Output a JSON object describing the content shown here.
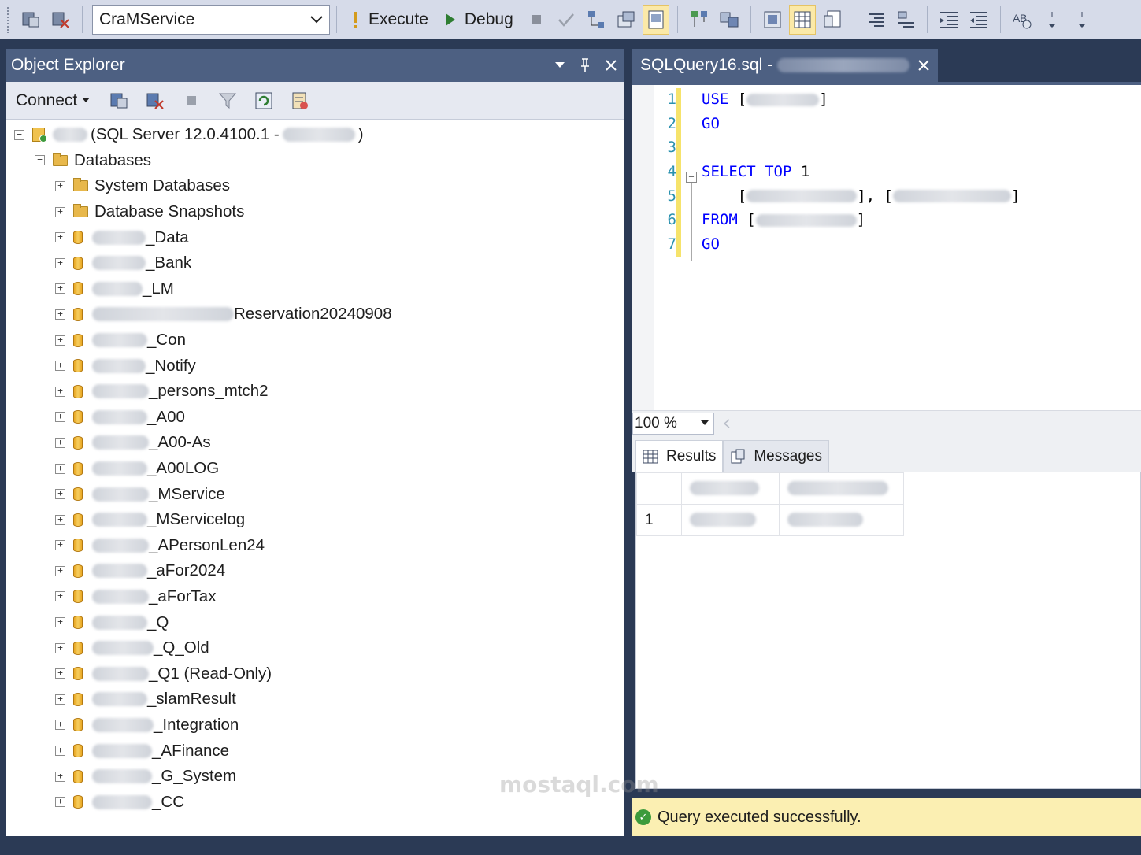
{
  "toolbar": {
    "database": "CraMService",
    "execute_label": "Execute",
    "debug_label": "Debug"
  },
  "object_explorer": {
    "title": "Object Explorer",
    "connect_label": "Connect",
    "server_label": "(SQL Server 12.0.4100.1 -",
    "server_close": ")",
    "databases_label": "Databases",
    "system_databases": "System Databases",
    "database_snapshots": "Database Snapshots",
    "databases": [
      "_Data",
      "_Bank",
      "_LM",
      "Reservation20240908",
      "_Con",
      "_Notify",
      "_persons_mtch2",
      "_A00",
      "_A00-As",
      "_A00LOG",
      "_MService",
      "_MServicelog",
      "_APersonLen24",
      "_aFor2024",
      "_aForTax",
      "_Q",
      "_Q_Old",
      "_Q1 (Read-Only)",
      "_slamResult",
      "_Integration",
      "_AFinance",
      "_G_System",
      "_CC"
    ]
  },
  "query": {
    "tab_title": "SQLQuery16.sql -",
    "line_numbers": [
      "1",
      "2",
      "3",
      "4",
      "5",
      "6",
      "7"
    ],
    "zoom": "100 %"
  },
  "results": {
    "results_tab": "Results",
    "messages_tab": "Messages",
    "row_number": "1",
    "status": "Query executed successfully."
  },
  "watermark": "mostaql.com"
}
